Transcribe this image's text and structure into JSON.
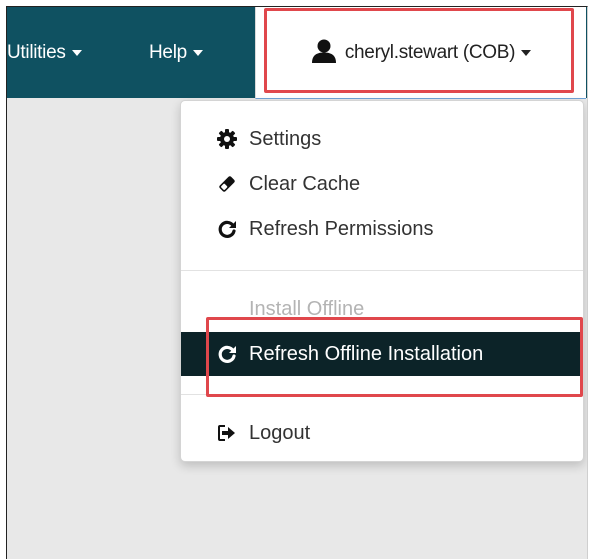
{
  "navbar": {
    "utilities_label": "Utilities",
    "help_label": "Help",
    "user_label": "cheryl.stewart (COB)"
  },
  "menu": {
    "settings": "Settings",
    "clear_cache": "Clear Cache",
    "refresh_permissions": "Refresh Permissions",
    "install_offline": "Install Offline",
    "refresh_offline_installation": "Refresh Offline Installation",
    "logout": "Logout"
  },
  "colors": {
    "navbar_bg": "#0f5161",
    "highlight_border": "#e0474c",
    "active_item_bg": "#0c2328"
  },
  "icons": {
    "settings": "gear-icon",
    "clear_cache": "eraser-icon",
    "refresh": "refresh-icon",
    "logout": "logout-icon",
    "user": "user-icon"
  }
}
